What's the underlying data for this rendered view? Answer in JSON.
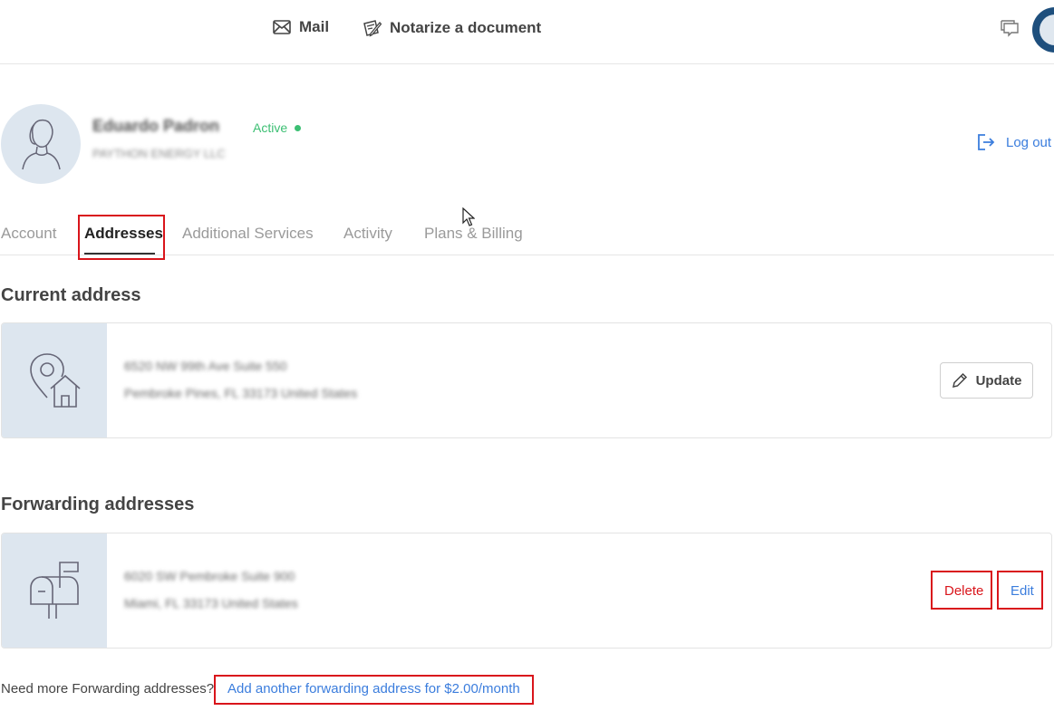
{
  "topnav": {
    "mail_label": "Mail",
    "notarize_label": "Notarize a document"
  },
  "profile": {
    "name": "Eduardo Padron",
    "company": "PAYTHON ENERGY LLC",
    "status": "Active",
    "logout_label": "Log out"
  },
  "tabs": [
    {
      "label": "Account",
      "active": false
    },
    {
      "label": "Addresses",
      "active": true
    },
    {
      "label": "Additional Services",
      "active": false
    },
    {
      "label": "Activity",
      "active": false
    },
    {
      "label": "Plans & Billing",
      "active": false
    }
  ],
  "current_address": {
    "title": "Current address",
    "line1": "6520 NW 99th Ave Suite 550",
    "line2": "Pembroke Pines, FL 33173 United States",
    "update_label": "Update"
  },
  "forwarding": {
    "title": "Forwarding addresses",
    "line1": "6020 SW Pembroke Suite 900",
    "line2": "Miami, FL 33173 United States",
    "delete_label": "Delete",
    "edit_label": "Edit",
    "more_text": "Need more Forwarding addresses?",
    "add_link": "Add another forwarding address for $2.00/month"
  },
  "colors": {
    "accent_blue": "#3b7ddd",
    "active_green": "#3cbf73",
    "delete_red": "#d9151b",
    "icon_panel": "#dde6ef",
    "highlight_red": "#d9151b"
  }
}
